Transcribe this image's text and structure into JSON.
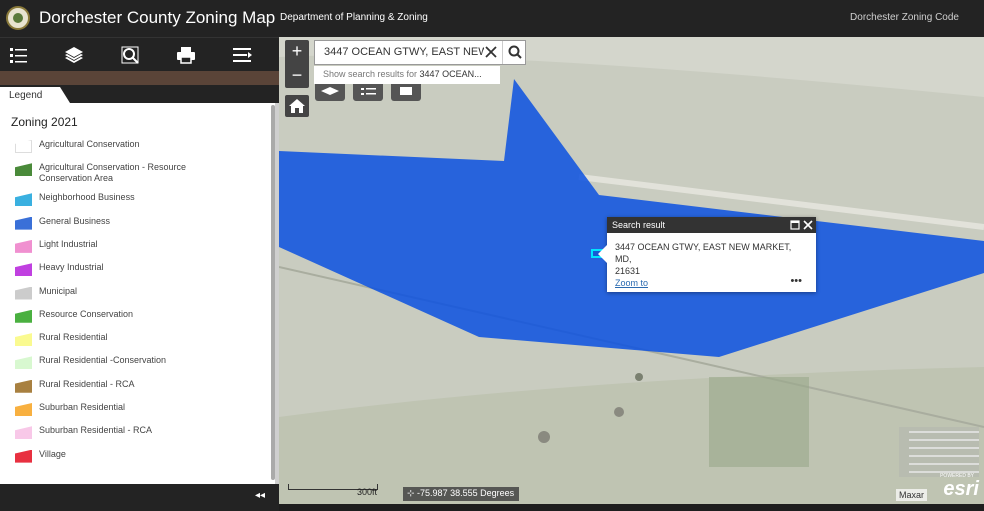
{
  "header": {
    "title": "Dorchester County Zoning Map",
    "subtitle": "Department of Planning & Zoning",
    "link": "Dorchester Zoning Code"
  },
  "toolbar": {
    "tools": [
      "list-icon",
      "layers-icon",
      "search-map-icon",
      "print-icon",
      "menu-icon"
    ]
  },
  "legend": {
    "tab_label": "Legend",
    "title": "Zoning 2021",
    "items": [
      {
        "label": "Agricultural Conservation",
        "color": "#ffffff"
      },
      {
        "label": "Agricultural Conservation - Resource Conservation Area",
        "color": "#4a8a3a"
      },
      {
        "label": "Neighborhood Business",
        "color": "#3ab0e0"
      },
      {
        "label": "General Business",
        "color": "#3a70d8"
      },
      {
        "label": "Light Industrial",
        "color": "#f090d0"
      },
      {
        "label": "Heavy Industrial",
        "color": "#c040e0"
      },
      {
        "label": "Municipal",
        "color": "#cccccc"
      },
      {
        "label": "Resource Conservation",
        "color": "#4ab040"
      },
      {
        "label": "Rural Residential",
        "color": "#fafa90"
      },
      {
        "label": "Rural Residential -Conservation",
        "color": "#d8f8d0"
      },
      {
        "label": "Rural Residential - RCA",
        "color": "#a88040"
      },
      {
        "label": "Suburban Residential",
        "color": "#f8b040"
      },
      {
        "label": "Suburban Residential - RCA",
        "color": "#f8c8e8"
      },
      {
        "label": "Village",
        "color": "#e83040"
      }
    ]
  },
  "map": {
    "zoom_in": "+",
    "zoom_out": "−",
    "search": {
      "value": "3447 OCEAN GTWY, EAST NEW",
      "suggest_prefix": "Show search results for ",
      "suggest_term": "3447 OCEAN..."
    },
    "popup": {
      "title": "Search result",
      "address_line1": "3447 OCEAN GTWY, EAST NEW MARKET, MD,",
      "address_line2": "21631",
      "zoom_link": "Zoom to",
      "more": "•••"
    },
    "scale_label": "300ft",
    "coordinates": "-75.987 38.555 Degrees",
    "attribution": "Maxar",
    "esri_powered": "POWERED BY",
    "esri_logo": "esri",
    "zone_color": "#0a50e0"
  },
  "footer": {
    "collapse_label": "◂◂"
  }
}
